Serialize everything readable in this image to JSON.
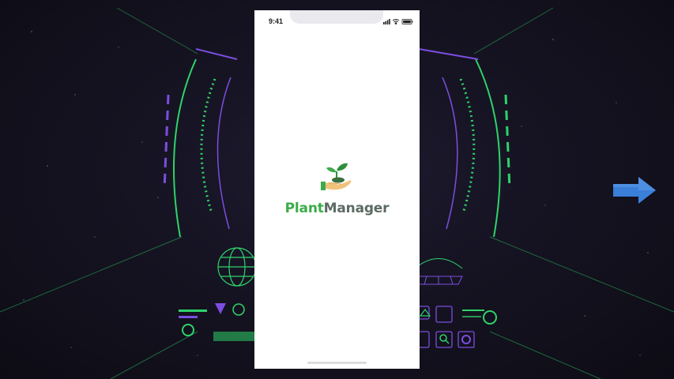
{
  "status_bar": {
    "time": "9:41"
  },
  "splash": {
    "logo_text_part1": "Plant",
    "logo_text_part2": "Manager",
    "logo_icon": "hand-with-sprout-icon"
  },
  "background": {
    "theme": "sci-fi hud",
    "colors": {
      "green": "#2fd36a",
      "purple": "#7b4ee0",
      "arrow": "#3a7fd8"
    }
  },
  "navigation": {
    "next_icon": "right-arrow-icon"
  }
}
